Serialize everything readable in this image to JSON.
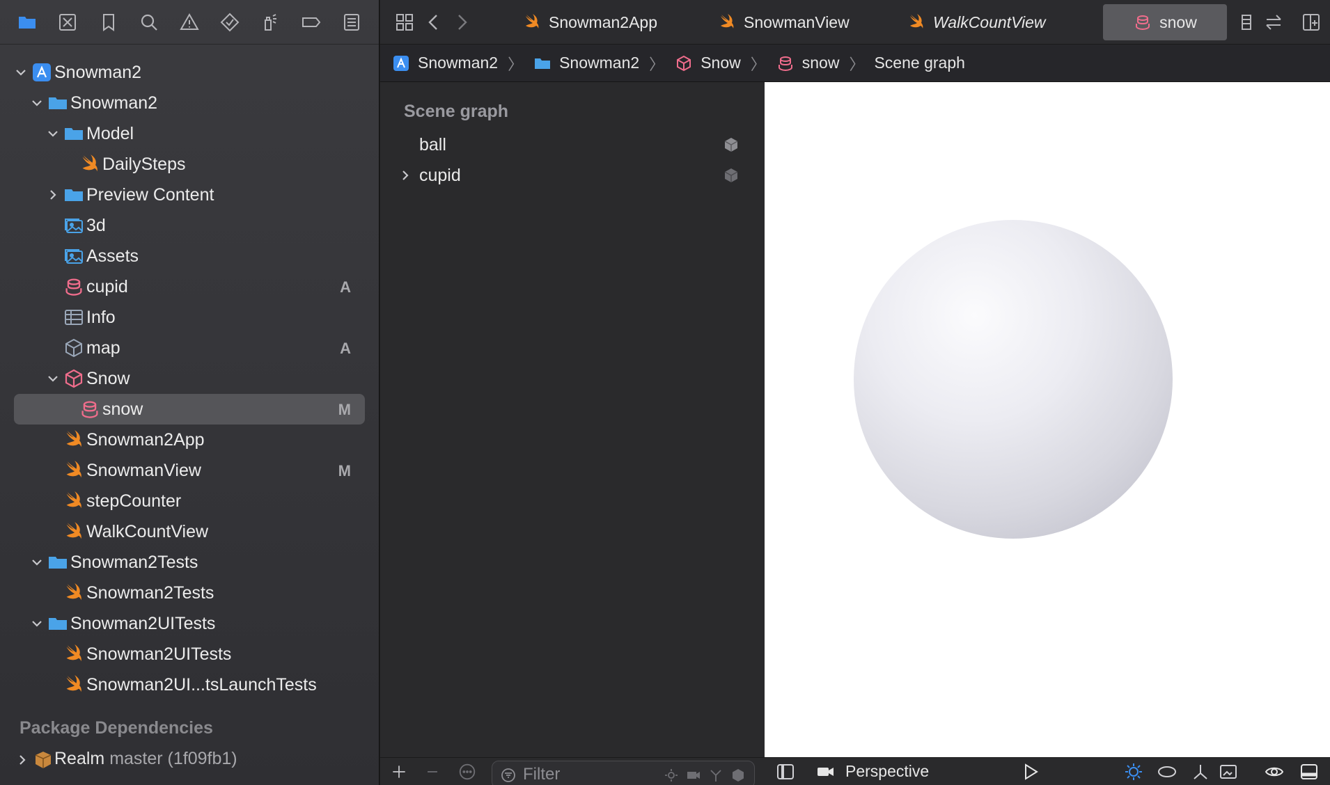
{
  "colors": {
    "folder": "#4aa3e8",
    "swift": "#f08a24",
    "reality": "#f06d8c",
    "accent_blue": "#3b8ef0"
  },
  "navigator": {
    "toolbar_icons": [
      "folder-icon",
      "source-control-icon",
      "bookmark-icon",
      "search-icon",
      "warning-icon",
      "test-diamond-icon",
      "debug-spray-icon",
      "breakpoint-icon",
      "report-icon"
    ],
    "items": [
      {
        "label": "Snowman2",
        "icon": "project",
        "level": 0,
        "chevron": "down",
        "badge": ""
      },
      {
        "label": "Snowman2",
        "icon": "folder",
        "level": 1,
        "chevron": "down",
        "badge": ""
      },
      {
        "label": "Model",
        "icon": "folder",
        "level": 2,
        "chevron": "down",
        "badge": ""
      },
      {
        "label": "DailySteps",
        "icon": "swift",
        "level": 3,
        "chevron": "",
        "badge": ""
      },
      {
        "label": "Preview Content",
        "icon": "folder",
        "level": 2,
        "chevron": "right",
        "badge": ""
      },
      {
        "label": "3d",
        "icon": "assets",
        "level": 2,
        "chevron": "",
        "badge": ""
      },
      {
        "label": "Assets",
        "icon": "assets",
        "level": 2,
        "chevron": "",
        "badge": ""
      },
      {
        "label": "cupid",
        "icon": "reality",
        "level": 2,
        "chevron": "",
        "badge": "A"
      },
      {
        "label": "Info",
        "icon": "table",
        "level": 2,
        "chevron": "",
        "badge": ""
      },
      {
        "label": "map",
        "icon": "cube",
        "level": 2,
        "chevron": "",
        "badge": "A"
      },
      {
        "label": "Snow",
        "icon": "rcproject",
        "level": 2,
        "chevron": "down",
        "badge": ""
      },
      {
        "label": "snow",
        "icon": "reality",
        "level": 3,
        "chevron": "",
        "badge": "M",
        "selected": true
      },
      {
        "label": "Snowman2App",
        "icon": "swift",
        "level": 2,
        "chevron": "",
        "badge": ""
      },
      {
        "label": "SnowmanView",
        "icon": "swift",
        "level": 2,
        "chevron": "",
        "badge": "M"
      },
      {
        "label": "stepCounter",
        "icon": "swift",
        "level": 2,
        "chevron": "",
        "badge": ""
      },
      {
        "label": "WalkCountView",
        "icon": "swift",
        "level": 2,
        "chevron": "",
        "badge": ""
      },
      {
        "label": "Snowman2Tests",
        "icon": "folder",
        "level": 1,
        "chevron": "down",
        "badge": ""
      },
      {
        "label": "Snowman2Tests",
        "icon": "swift",
        "level": 2,
        "chevron": "",
        "badge": ""
      },
      {
        "label": "Snowman2UITests",
        "icon": "folder",
        "level": 1,
        "chevron": "down",
        "badge": ""
      },
      {
        "label": "Snowman2UITests",
        "icon": "swift",
        "level": 2,
        "chevron": "",
        "badge": ""
      },
      {
        "label": "Snowman2UI...tsLaunchTests",
        "icon": "swift",
        "level": 2,
        "chevron": "",
        "badge": ""
      }
    ],
    "packages_heading": "Package Dependencies",
    "package": {
      "name": "Realm",
      "version": "master (1f09fb1)"
    }
  },
  "tabs": [
    {
      "label": "Snowman2App",
      "icon": "swift",
      "italic": false,
      "active": false
    },
    {
      "label": "SnowmanView",
      "icon": "swift",
      "italic": false,
      "active": false
    },
    {
      "label": "WalkCountView",
      "icon": "swift",
      "italic": true,
      "active": false
    },
    {
      "label": "snow",
      "icon": "reality",
      "italic": false,
      "active": true
    }
  ],
  "breadcrumb": [
    {
      "label": "Snowman2",
      "icon": "project"
    },
    {
      "label": "Snowman2",
      "icon": "folder"
    },
    {
      "label": "Snow",
      "icon": "rcproject"
    },
    {
      "label": "snow",
      "icon": "reality"
    },
    {
      "label": "Scene graph",
      "icon": ""
    }
  ],
  "scene_graph": {
    "title": "Scene graph",
    "items": [
      {
        "label": "ball",
        "expandable": false
      },
      {
        "label": "cupid",
        "expandable": true
      }
    ],
    "filter_placeholder": "Filter"
  },
  "viewport": {
    "camera_mode": "Perspective"
  }
}
